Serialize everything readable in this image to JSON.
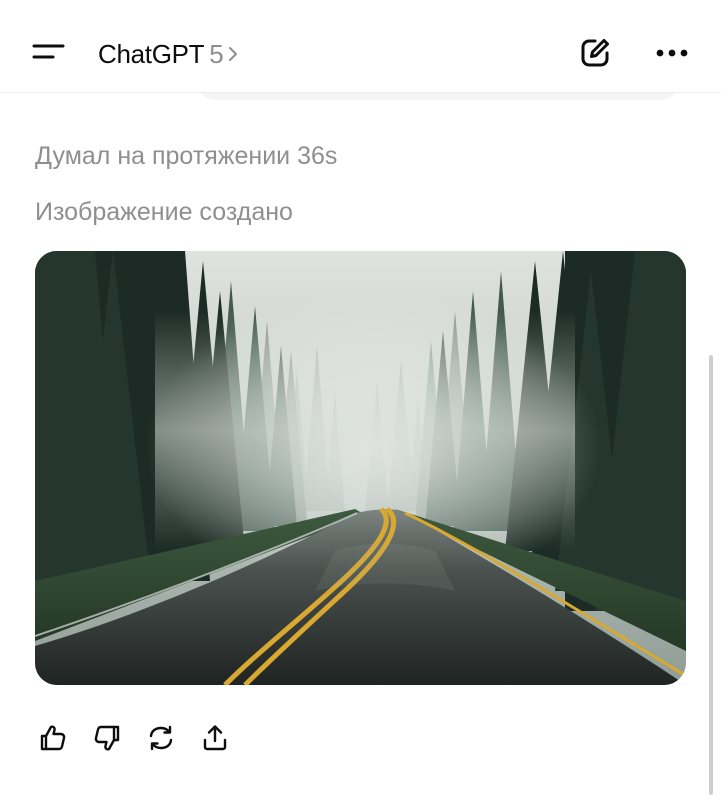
{
  "header": {
    "title": "ChatGPT",
    "model_version": "5",
    "icons": {
      "menu": "menu-icon",
      "chevron": "chevron-right-icon",
      "new_chat": "new-chat-edit-icon",
      "more": "more-horizontal-icon"
    }
  },
  "message": {
    "thought_status": "Думал на протяжении 36s",
    "image_status": "Изображение создано",
    "image": {
      "subject": "generated-image"
    }
  },
  "actions": {
    "icons": [
      "thumbs-up-icon",
      "thumbs-down-icon",
      "regenerate-icon",
      "share-icon"
    ]
  },
  "colors": {
    "text_primary": "#0d0d0d",
    "text_secondary": "#8f8f8f",
    "road_line": "#d9a830",
    "forest_dark": "#1a2a24"
  }
}
